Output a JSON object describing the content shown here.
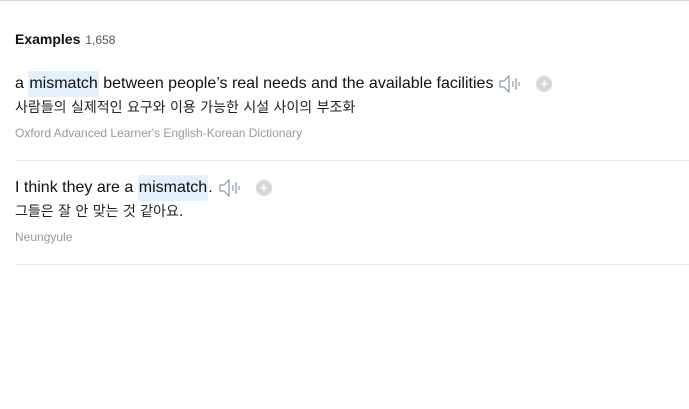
{
  "header": {
    "title": "Examples",
    "count": "1,658"
  },
  "examples": [
    {
      "en_before": "a ",
      "en_highlight": "mismatch",
      "en_after": " between people’s real needs and the available facilities",
      "ko": "사람들의 실제적인 요구와 이용 가능한 시설 사이의 부조화",
      "source": "Oxford Advanced Learner's English-Korean Dictionary",
      "speaker_icon": "speaker-icon",
      "add_icon": "plus-circle-icon"
    },
    {
      "en_before": "I think they are a ",
      "en_highlight": "mismatch",
      "en_after": ".",
      "ko": "그들은 잘 안 맞는 것 같아요.",
      "source": "Neungyule",
      "speaker_icon": "speaker-icon",
      "add_icon": "plus-circle-icon"
    }
  ],
  "colors": {
    "highlight": "#e3f0fc",
    "icon": "#8a9bb0",
    "plus_bg": "#d6d6d6"
  }
}
